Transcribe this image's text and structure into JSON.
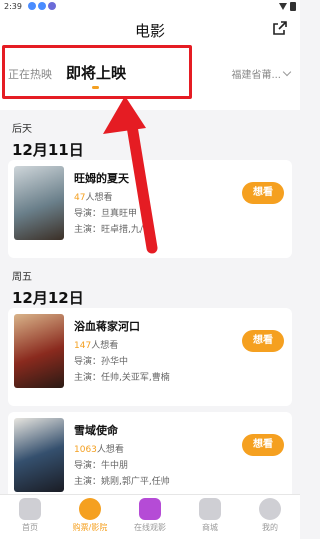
{
  "status_bar": {
    "time": "2:39"
  },
  "header": {
    "title": "电影",
    "tabs": [
      {
        "label": "正在热映",
        "active": false
      },
      {
        "label": "即将上映",
        "active": true
      }
    ],
    "city": "福建省莆..."
  },
  "sections": [
    {
      "weekday": "后天",
      "date": "12月11日",
      "movies": [
        {
          "title": "旺姆的夏天",
          "want_count": "47",
          "want_suffix": "人想看",
          "director": "导演：旦真旺甲",
          "cast": "主演：旺卓措,九/",
          "button": "想看",
          "poster_color": "#6a7f8a"
        }
      ]
    },
    {
      "weekday": "周五",
      "date": "12月12日",
      "movies": [
        {
          "title": "浴血蒋家河口",
          "want_count": "147",
          "want_suffix": "人想看",
          "director": "导演：孙华中",
          "cast": "主演：任帅,关亚军,曹楠",
          "button": "想看",
          "poster_color": "#8a2a1e"
        },
        {
          "title": "雪域使命",
          "want_count": "1063",
          "want_suffix": "人想看",
          "director": "导演：牛中朋",
          "cast": "主演：姚刚,郭广平,任帅",
          "button": "想看",
          "poster_color": "#35506e"
        }
      ]
    }
  ],
  "tabbar": [
    {
      "label": "首页",
      "icon": "home-icon"
    },
    {
      "label": "购票/影院",
      "icon": "film-reel-icon",
      "active": true
    },
    {
      "label": "在线观影",
      "icon": "play-icon"
    },
    {
      "label": "商城",
      "icon": "shop-bag-icon"
    },
    {
      "label": "我的",
      "icon": "profile-icon"
    }
  ],
  "colors": {
    "accent": "#f5a020",
    "highlight": "#e51c23"
  }
}
